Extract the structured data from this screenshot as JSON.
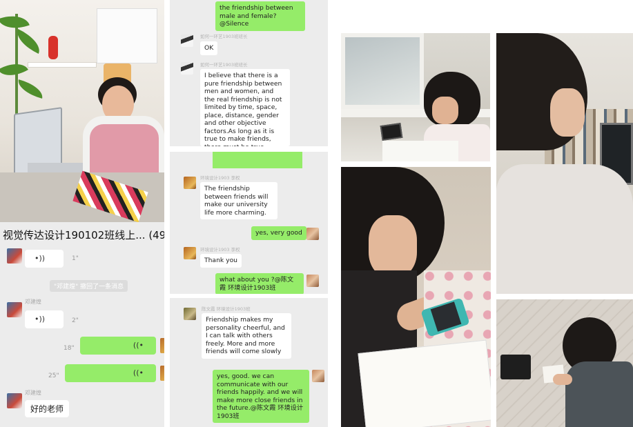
{
  "collage": {
    "panel1": {
      "chat_title": "视觉传达设计190102班线上... (49)",
      "voice_messages": [
        {
          "side": "left",
          "duration": "1\""
        },
        {
          "side": "left",
          "duration": "2\""
        },
        {
          "side": "right",
          "duration": "18\""
        },
        {
          "side": "right",
          "duration": "25\""
        }
      ],
      "sender_1": "邓建煌",
      "sender_2": "邓建煌",
      "system_notice": "\"邓建煌\" 撤回了一条消息",
      "text_message": "好的老师"
    },
    "panel2": {
      "top_bubble": "the friendship between male and female?@Silence",
      "meta_1": "如何一环艺1903班班长",
      "bubble_ok": "OK",
      "meta_2": "如何一环艺1903班班长",
      "bubble_long": "I believe that there is a pure friendship between men and women, and the real friendship is not limited by time, space, place, distance, gender and other objective factors.As long as it is true to make friends, there must be true friendship between"
    },
    "panel3": {
      "meta_1": "环境设计1903 李权",
      "bubble_1": "The friendship between friends will make our university life more charming.",
      "bubble_2": "yes, very good",
      "meta_2": "环境设计1903 李权",
      "bubble_3": "Thank you",
      "bubble_4": "what about you ?@陈文霞 环境设计1903班"
    },
    "panel4": {
      "meta_1": "陈文霞 环境设计1903班",
      "bubble_1": "Friendship makes my personality cheerful, and I can talk with others freely. More and more friends will come slowly",
      "bubble_2": "yes, good. we can communicate with our friends happily. and we will make more close friends in the future.@陈文霞 环境设计1903班"
    },
    "colors": {
      "wechat_green": "#95ec69",
      "chat_background": "#ececec",
      "bubble_white": "#ffffff"
    }
  }
}
